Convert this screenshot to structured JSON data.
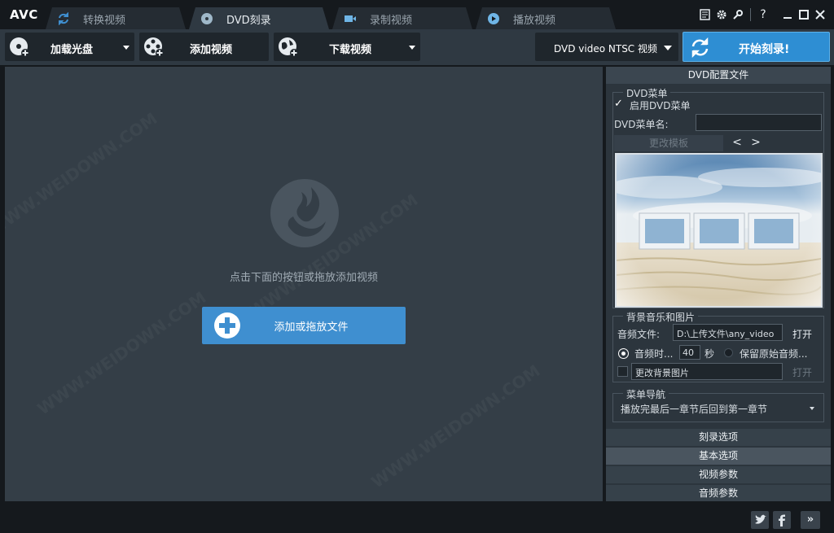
{
  "app": {
    "logo": "AVC"
  },
  "tabs": [
    {
      "label": "转换视频",
      "icon": "convert-icon",
      "active": false
    },
    {
      "label": "DVD刻录",
      "icon": "disc-icon",
      "active": true
    },
    {
      "label": "录制视频",
      "icon": "record-icon",
      "active": false
    },
    {
      "label": "播放视频",
      "icon": "play-icon",
      "active": false
    }
  ],
  "window_controls": [
    "log-icon",
    "settings-icon",
    "skin-icon",
    "help-icon",
    "minimize-icon",
    "maximize-icon",
    "close-icon"
  ],
  "window_controls_text": {
    "help": "?"
  },
  "toolbar": {
    "load_disc": "加载光盘",
    "add_video": "添加视频",
    "download_video": "下载视频",
    "profile": "DVD video NTSC 视频",
    "burn": "开始刻录!"
  },
  "main": {
    "hint": "点击下面的按钮或拖放添加视频",
    "add_file_button": "添加或拖放文件",
    "watermark": "WWW.WEIDOWN.COM"
  },
  "panel": {
    "title": "DVD配置文件",
    "dvd_menu": {
      "legend": "DVD菜单",
      "enable_label": "启用DVD菜单",
      "enable_checked": true,
      "name_label": "DVD菜单名:",
      "name_value": "",
      "change_template": "更改模板",
      "prev": "<",
      "next": ">"
    },
    "bg": {
      "legend": "背景音乐和图片",
      "audio_label": "音频文件:",
      "audio_value": "D:\\上传文件\\any_video",
      "open": "打开",
      "duration_label": "音频时...",
      "duration_value": "40",
      "seconds": "秒",
      "keep_original": "保留原始音频...",
      "change_bg": "更改背景图片",
      "open_disabled": "打开"
    },
    "nav": {
      "legend": "菜单导航",
      "value": "播放完最后一章节后回到第一章节"
    },
    "sections": [
      {
        "label": "刻录选项",
        "selected": false
      },
      {
        "label": "基本选项",
        "selected": true
      },
      {
        "label": "视频参数",
        "selected": false
      },
      {
        "label": "音频参数",
        "selected": false
      }
    ]
  },
  "bottom": {
    "twitter": "twitter-icon",
    "facebook": "facebook-icon",
    "expand": "»"
  },
  "colors": {
    "accent": "#3f8fd0",
    "burn": "#2e8ed3",
    "bg": "#343e47",
    "panel": "#2c353d"
  }
}
